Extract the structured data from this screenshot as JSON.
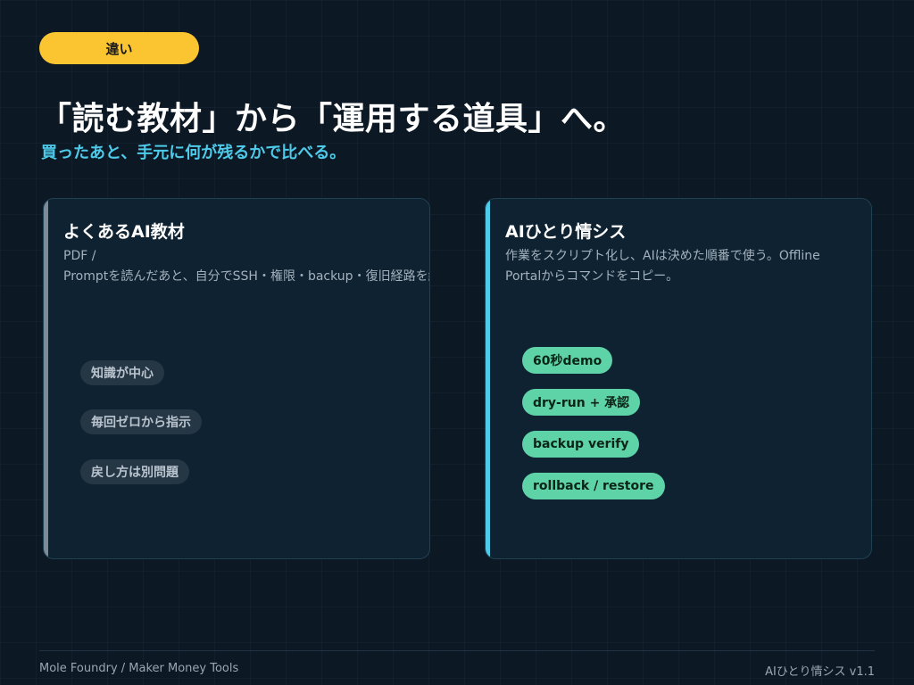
{
  "badge": "違い",
  "title": "「読む教材」から「運用する道具」へ。",
  "subtitle": "買ったあと、手元に何が残るかで比べる。",
  "cards": [
    {
      "title": "よくあるAI教材",
      "desc_line1": "PDF /",
      "desc_line2": "Promptを読んだあと、自分でSSH・権限・backup・復旧経路を組み",
      "tags": [
        "知識が中心",
        "毎回ゼロから指示",
        "戻し方は別問題"
      ],
      "accent_color": "#7e8a96"
    },
    {
      "title": "AIひとり情シス",
      "desc_line1": "作業をスクリプト化し、AIは決めた順番で使う。Offline",
      "desc_line2": "Portalからコマンドをコピー。",
      "tags": [
        "60秒demo",
        "dry-run + 承認",
        "backup verify",
        "rollback / restore"
      ],
      "accent_color": "#4ecbea"
    }
  ],
  "footer": {
    "left": "Mole Foundry / Maker Money Tools",
    "right": "AIひとり情シス v1.1"
  },
  "colors": {
    "badge": "#fbc531",
    "subtitle": "#4ecbea",
    "tag_green": "#5fd3a8",
    "background": "#0c1824"
  }
}
